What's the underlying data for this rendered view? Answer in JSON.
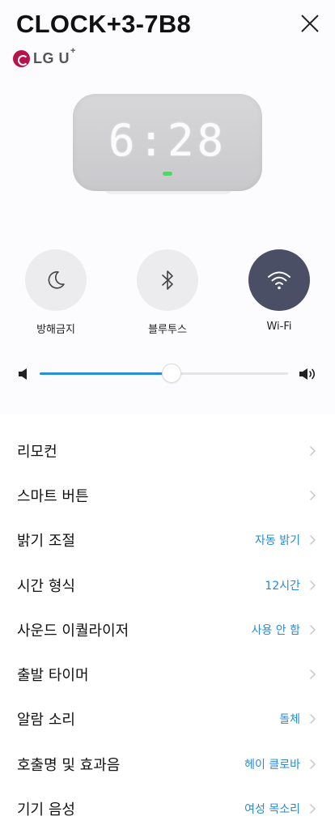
{
  "header": {
    "title": "CLOCK+3-7B8",
    "brand": "LG U",
    "brand_sup": "+"
  },
  "device": {
    "time": "6:28"
  },
  "quick_toggles": [
    {
      "label": "방해금지",
      "icon": "moon-icon",
      "active": false
    },
    {
      "label": "블루투스",
      "icon": "bluetooth-icon",
      "active": false
    },
    {
      "label": "Wi-Fi",
      "icon": "wifi-icon",
      "active": true
    }
  ],
  "volume": {
    "level": 0.53
  },
  "menu": [
    {
      "label": "리모컨",
      "value": ""
    },
    {
      "label": "스마트 버튼",
      "value": ""
    },
    {
      "label": "밝기 조절",
      "value": "자동 밝기"
    },
    {
      "label": "시간 형식",
      "value": "12시간"
    },
    {
      "label": "사운드 이퀄라이저",
      "value": "사용 안 함"
    },
    {
      "label": "출발 타이머",
      "value": ""
    },
    {
      "label": "알람 소리",
      "value": "돌체"
    },
    {
      "label": "호출명 및 효과음",
      "value": "헤이 클로바"
    },
    {
      "label": "기기 음성",
      "value": "여성 목소리"
    }
  ],
  "colors": {
    "accent": "#2a8ad6",
    "active_toggle": "#4a4f66",
    "brand": "#b7134b",
    "led": "#52d46b"
  }
}
